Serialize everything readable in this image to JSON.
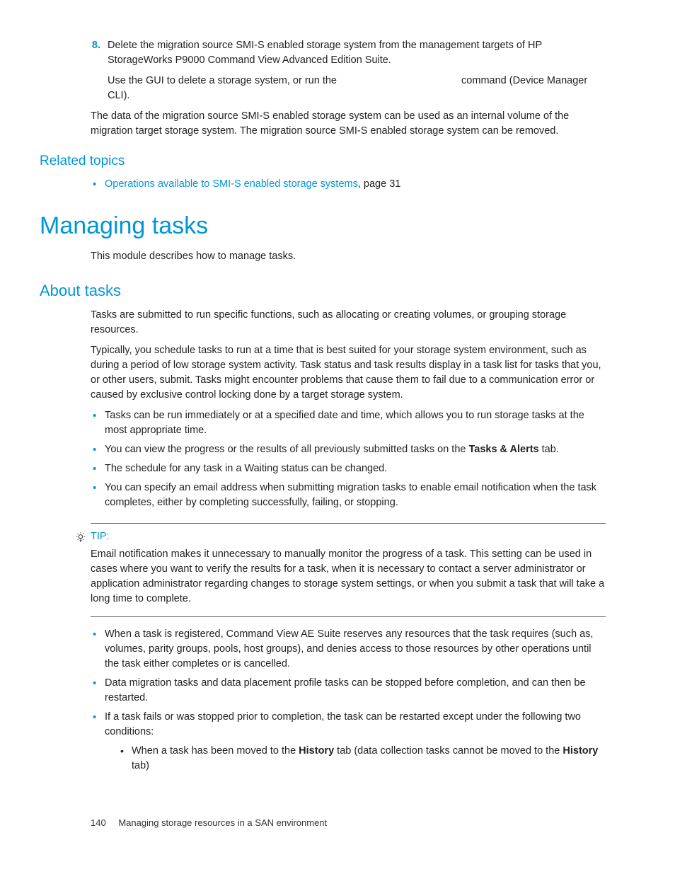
{
  "step8": {
    "num": "8.",
    "text": "Delete the migration source SMI-S enabled storage system from the management targets of HP StorageWorks P9000 Command View Advanced Edition Suite.",
    "sub_pre": "Use the GUI to delete a storage system, or run the ",
    "sub_post": " command (Device Manager CLI)."
  },
  "para_after": "The data of the migration source SMI-S enabled storage system can be used as an internal volume of the migration target storage system. The migration source SMI-S enabled storage system can be removed.",
  "related": {
    "heading": "Related topics",
    "link_text": "Operations available to SMI-S enabled storage systems",
    "link_suffix": ", page 31"
  },
  "h1": "Managing tasks",
  "h1_intro": "This module describes how to manage tasks.",
  "h2": "About tasks",
  "about_p1": "Tasks are submitted to run specific functions, such as allocating or creating volumes, or grouping storage resources.",
  "about_p2": "Typically, you schedule tasks to run at a time that is best suited for your storage system environment, such as during a period of low storage system activity. Task status and task results display in a task list for tasks that you, or other users, submit. Tasks might encounter problems that cause them to fail due to a communication error or caused by exclusive control locking done by a target storage system.",
  "bullets1": {
    "b1": "Tasks can be run immediately or at a specified date and time, which allows you to run storage tasks at the most appropriate time.",
    "b2_pre": "You can view the progress or the results of all previously submitted tasks on the ",
    "b2_bold": "Tasks & Alerts",
    "b2_post": " tab.",
    "b3": "The schedule for any task in a Waiting status can be changed.",
    "b4": "You can specify an email address when submitting migration tasks to enable email notification when the task completes, either by completing successfully, failing, or stopping."
  },
  "tip": {
    "label": "TIP:",
    "body": "Email notification makes it unnecessary to manually monitor the progress of a task. This setting can be used in cases where you want to verify the results for a task, when it is necessary to contact a server administrator or application administrator regarding changes to storage system settings, or when you submit a task that will take a long time to complete."
  },
  "bullets2": {
    "b1": "When a task is registered, Command View AE Suite reserves any resources that the task requires (such as, volumes, parity groups, pools, host groups), and denies access to those resources by other operations until the task either completes or is cancelled.",
    "b2": "Data migration tasks and data placement profile tasks can be stopped before completion, and can then be restarted.",
    "b3": "If a task fails or was stopped prior to completion, the task can be restarted except under the following two conditions:",
    "b3_sub_pre": "When a task has been moved to the ",
    "b3_sub_b1": "History",
    "b3_sub_mid": " tab (data collection tasks cannot be moved to the ",
    "b3_sub_b2": "History",
    "b3_sub_post": " tab)"
  },
  "footer": {
    "page": "140",
    "title": "Managing storage resources in a SAN environment"
  }
}
